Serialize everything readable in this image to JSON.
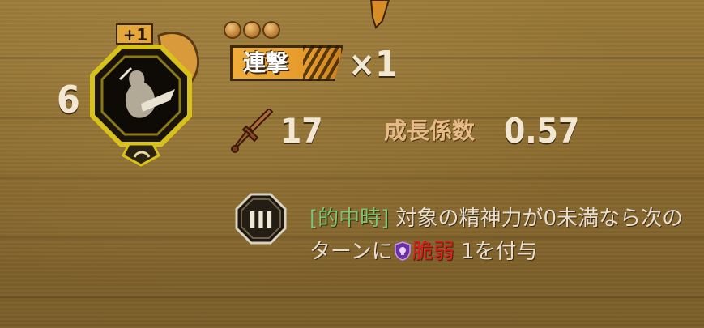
{
  "skill": {
    "level": "6",
    "plus_badge": "+1",
    "coin_count": 3,
    "name": "連撃",
    "multiplier": "×1",
    "power": "17",
    "growth_label": "成長係数",
    "growth_value": "0.57",
    "rank_numeral": "III",
    "effect": {
      "condition": "[的中時]",
      "text_before": " 対象の精神力が0未満なら次のターンに",
      "status_icon": "shield-skull-icon",
      "status_name": "脆弱",
      "text_after": " 1を付与"
    }
  },
  "colors": {
    "banner": "#e59a2a",
    "condition": "#7fc472",
    "status": "#e01b1b",
    "portrait_frame": "#d8c21a"
  }
}
